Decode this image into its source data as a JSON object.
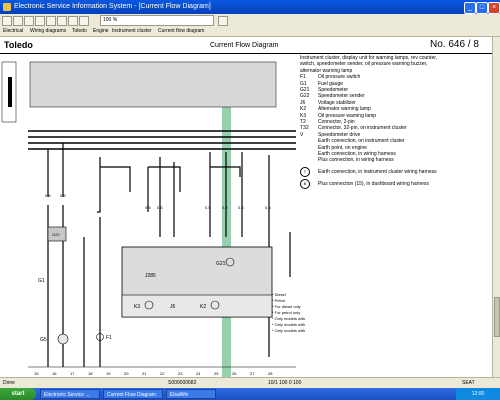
{
  "window": {
    "title": "Electronic Service Information System - [Current Flow Diagram]",
    "zoom": "100 %"
  },
  "nav": {
    "items": [
      "Electrical",
      "Wiring diagrams",
      "Toledo",
      "Engine",
      "Instrument cluster",
      "Current flow diagram"
    ]
  },
  "header": {
    "model": "Toledo",
    "section": "Current Flow Diagram",
    "page_no": "No.  646 / 8"
  },
  "legend": {
    "intro": [
      "Instrument cluster, display unit for warning lamps, rev counter,",
      "switch, speedometer sender, oil pressure warning buzzer,",
      "alternator warning lamp"
    ],
    "rows": [
      {
        "k": "F1",
        "d": "Oil pressure switch"
      },
      {
        "k": "G1",
        "d": "Fuel gauge"
      },
      {
        "k": "G21",
        "d": "Speedometer"
      },
      {
        "k": "G22",
        "d": "Speedometer sender"
      },
      {
        "k": "J6",
        "d": "Voltage stabilizer"
      },
      {
        "k": "K2",
        "d": "Alternator warning lamp"
      },
      {
        "k": "K3",
        "d": "Oil pressure warning lamp"
      },
      {
        "k": "T2",
        "d": "Connector, 2-pin"
      },
      {
        "k": "T32",
        "d": "Connector, 32-pin, on instrument cluster"
      },
      {
        "k": "V",
        "d": "Speedometer drive"
      },
      {
        "k": "",
        "d": "Earth connection, on instrument cluster"
      },
      {
        "k": "",
        "d": "Earth point, on engine"
      },
      {
        "k": "",
        "d": "Earth connection, in wiring harness"
      },
      {
        "k": "",
        "d": "Plus connection, in wiring harness"
      }
    ],
    "circle_notes": [
      {
        "k": "T",
        "d": "Earth connection, in instrument cluster wiring harness"
      },
      {
        "k": "B",
        "d": "Plus connection (15), in dashboard wiring harness"
      }
    ],
    "small_notes": [
      "* Diesel",
      "* Petrol",
      "* For diesel only",
      "* For petrol only",
      "* Only models with",
      "* Only models with",
      "* Only models with"
    ]
  },
  "schematic": {
    "components": {
      "cluster": "J285",
      "k2": "K2",
      "k3": "K3",
      "j6": "J6",
      "g22": "G22",
      "g1": "G1",
      "f1": "F1",
      "g5": "G5",
      "g21": "G21"
    },
    "column_numbers": [
      "15",
      "16",
      "17",
      "18",
      "19",
      "20",
      "21",
      "22",
      "23",
      "24",
      "25",
      "26",
      "27",
      "28"
    ]
  },
  "status": {
    "left": "Done",
    "doc_no": "S000000682",
    "pages": "10/1  100  0  100",
    "right": "SEAT"
  },
  "taskbar": {
    "start": "start",
    "items": [
      "Electronic Service ...",
      "Current Flow Diagram",
      "ElsaWin"
    ],
    "clock": "12:00"
  },
  "colors": {
    "highlight": "#86c8a0",
    "titlebar": "#0a58e0"
  }
}
